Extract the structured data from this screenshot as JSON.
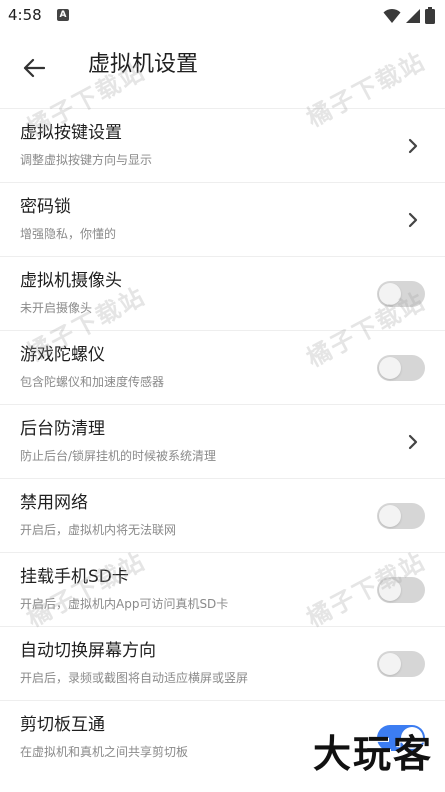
{
  "status_bar": {
    "time": "4:58",
    "notif_glyph": "A"
  },
  "header": {
    "title": "虚拟机设置"
  },
  "settings": [
    {
      "title": "虚拟按键设置",
      "subtitle": "调整虚拟按键方向与显示",
      "control": "chevron"
    },
    {
      "title": "密码锁",
      "subtitle": "增强隐私，你懂的",
      "control": "chevron"
    },
    {
      "title": "虚拟机摄像头",
      "subtitle": "未开启摄像头",
      "control": "toggle",
      "on": false
    },
    {
      "title": "游戏陀螺仪",
      "subtitle": "包含陀螺仪和加速度传感器",
      "control": "toggle",
      "on": false
    },
    {
      "title": "后台防清理",
      "subtitle": "防止后台/锁屏挂机的时候被系统清理",
      "control": "chevron"
    },
    {
      "title": "禁用网络",
      "subtitle": "开启后，虚拟机内将无法联网",
      "control": "toggle",
      "on": false
    },
    {
      "title": "挂载手机SD卡",
      "subtitle": "开启后，虚拟机内App可访问真机SD卡",
      "control": "toggle",
      "on": false
    },
    {
      "title": "自动切换屏幕方向",
      "subtitle": "开启后，录频或截图将自动适应横屏或竖屏",
      "control": "toggle",
      "on": false
    },
    {
      "title": "剪切板互通",
      "subtitle": "在虚拟机和真机之间共享剪切板",
      "control": "toggle",
      "on": true
    }
  ],
  "watermark_text": "橘子下载站",
  "corner_logo": "大玩客",
  "colors": {
    "toggle_on": "#3c7df2",
    "toggle_off": "#d6d6d6"
  }
}
